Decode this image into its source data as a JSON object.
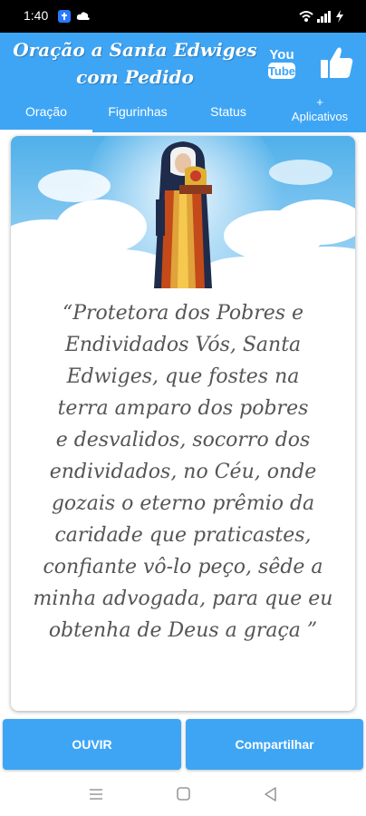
{
  "status_bar": {
    "time": "1:40"
  },
  "header": {
    "title_line1": "Oração a Santa Edwiges",
    "title_line2": "com Pedido",
    "youtube_label": "You Tube"
  },
  "tabs": [
    {
      "label": "Oração",
      "active": true
    },
    {
      "label": "Figurinhas",
      "active": false
    },
    {
      "label": "Status",
      "active": false
    },
    {
      "label_line1": "+",
      "label_line2": "Aplicativos",
      "active": false
    }
  ],
  "prayer": {
    "lines": [
      "“Protetora dos Pobres e",
      "Endividados Vós, Santa",
      "Edwiges, que fostes na",
      "terra amparo dos pobres",
      "e desvalidos, socorro dos",
      "endividados, no Céu, onde",
      "gozais o eterno prêmio da",
      "caridade que praticastes,",
      "confiante vô-lo peço, sêde a",
      "minha advogada, para que eu",
      "obtenha de Deus a graça ”"
    ]
  },
  "buttons": {
    "listen": "OUVIR",
    "share": "Compartilhar"
  },
  "colors": {
    "primary": "#3ea5f5",
    "text": "#555555"
  }
}
